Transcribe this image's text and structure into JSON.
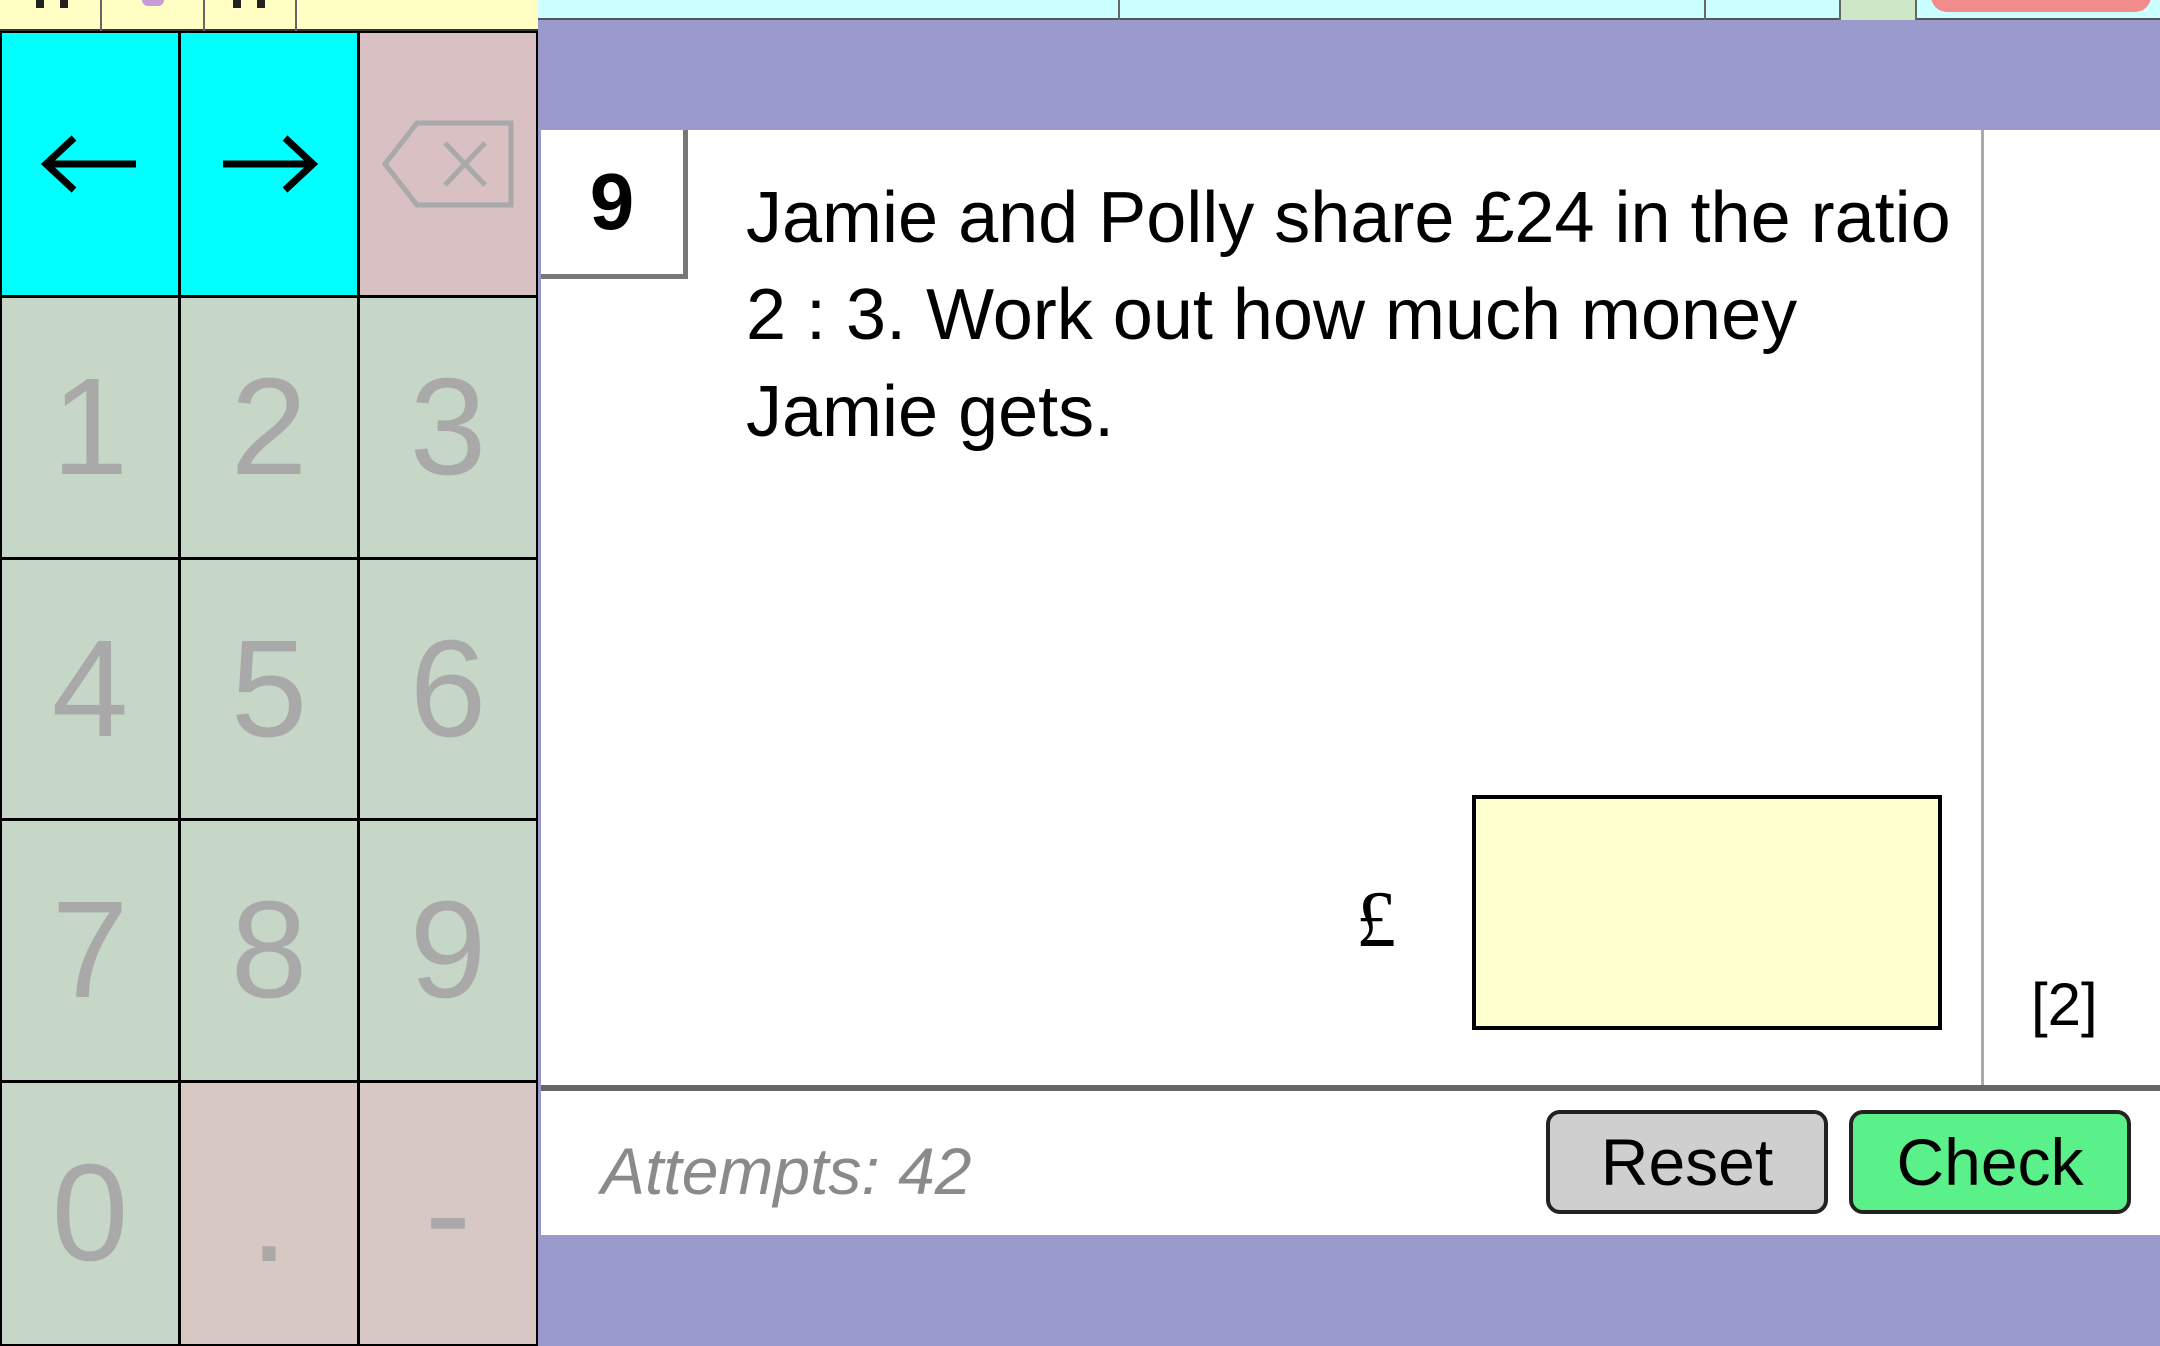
{
  "keypad": {
    "left_arrow": "←",
    "right_arrow": "→",
    "backspace_icon": "backspace-icon",
    "digits": [
      "1",
      "2",
      "3",
      "4",
      "5",
      "6",
      "7",
      "8",
      "9",
      "0"
    ],
    "decimal": ".",
    "minus": "-"
  },
  "question": {
    "number": "9",
    "text": "Jamie and Polly share £24 in the ratio 2 : 3. Work out how much money Jamie gets.",
    "currency_symbol": "£",
    "answer_value": "",
    "marks": "[2]"
  },
  "footer": {
    "attempts": "Attempts: 42",
    "reset_label": "Reset",
    "check_label": "Check"
  },
  "colors": {
    "nav_key": "#00ffff",
    "digit_key": "#c6d6c7",
    "answer_box": "#ffffcf",
    "check_button": "#5af08a",
    "background": "#9b9acd"
  }
}
